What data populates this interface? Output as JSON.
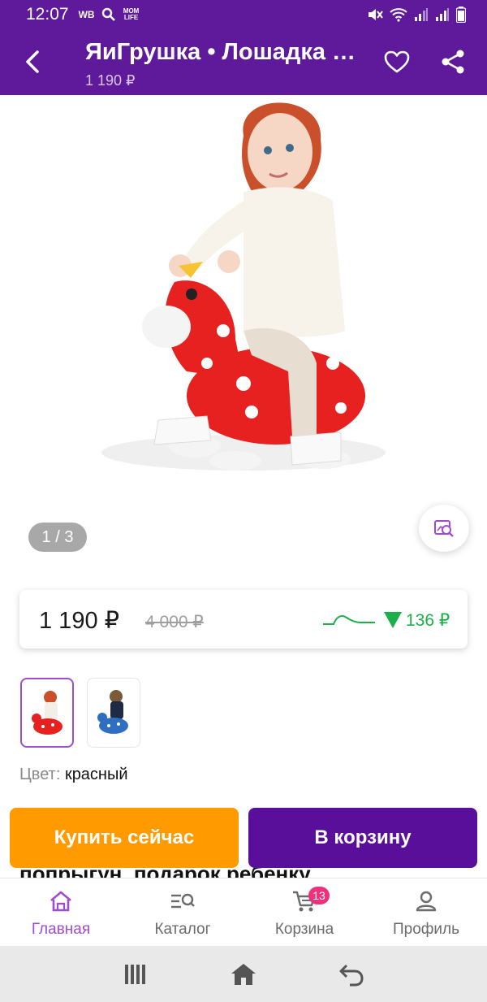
{
  "status_bar": {
    "time": "12:07",
    "app_wb": "WB",
    "app_momlife": "MOM LIFE"
  },
  "header": {
    "title": "ЯиГрушка • Лошадка прыгун",
    "price": "1 190 ₽"
  },
  "gallery": {
    "counter": "1 / 3"
  },
  "price_card": {
    "current": "1 190 ₽",
    "old": "4 000 ₽",
    "drop": "136 ₽",
    "accent_green": "#1cb04a"
  },
  "variant": {
    "label": "Цвет:",
    "value": "красный"
  },
  "description_peek": {
    "line1": "попрыгун, подарок ребенку",
    "line1_tail": ","
  },
  "actions": {
    "buy_now": "Купить сейчас",
    "add_to_cart": "В корзину"
  },
  "bottom_nav": {
    "items": [
      {
        "label": "Главная",
        "icon": "home-icon",
        "active": true
      },
      {
        "label": "Каталог",
        "icon": "catalog-icon"
      },
      {
        "label": "Корзина",
        "icon": "cart-icon",
        "badge": "13"
      },
      {
        "label": "Профиль",
        "icon": "profile-icon"
      }
    ]
  },
  "colors": {
    "brand_purple": "#5f1a9c",
    "orange": "#ff9a00",
    "badge_pink": "#f0307a"
  }
}
